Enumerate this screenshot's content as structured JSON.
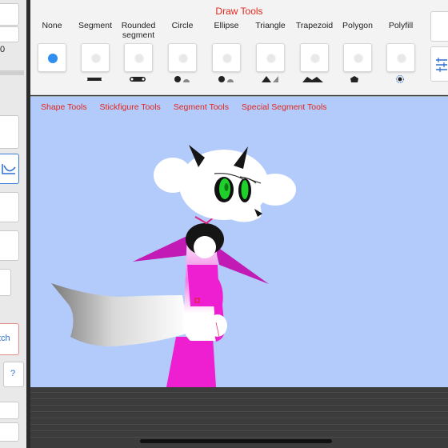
{
  "left_panel": {
    "value_text": "0",
    "match_button": "tch",
    "help_button": "?"
  },
  "toolbar": {
    "title": "Draw Tools",
    "selected_tool": "None",
    "tools": [
      {
        "label": "None",
        "icon": "dot-icon"
      },
      {
        "label": "Segment",
        "icon": "segment-icon"
      },
      {
        "label": "Rounded segment",
        "icon": "rounded-segment-icon"
      },
      {
        "label": "Circle",
        "icon": "circle-icon"
      },
      {
        "label": "Ellipse",
        "icon": "ellipse-icon"
      },
      {
        "label": "Triangle",
        "icon": "triangle-icon"
      },
      {
        "label": "Trapezoid",
        "icon": "trapezoid-icon"
      },
      {
        "label": "Polygon",
        "icon": "polygon-icon"
      },
      {
        "label": "Polyfill",
        "icon": "polyfill-icon"
      }
    ]
  },
  "canvas": {
    "tabs": [
      "Shape Tools",
      "Stickfigure Tools",
      "Segment Tools",
      "Special Segment Tools"
    ],
    "background": "#b2cbfb",
    "accent_magenta": "#ee1fd0",
    "eye_green": "#1fcf2a"
  },
  "colors": {
    "accent_red": "#e2271c",
    "selected_blue": "#2f8ef0"
  }
}
